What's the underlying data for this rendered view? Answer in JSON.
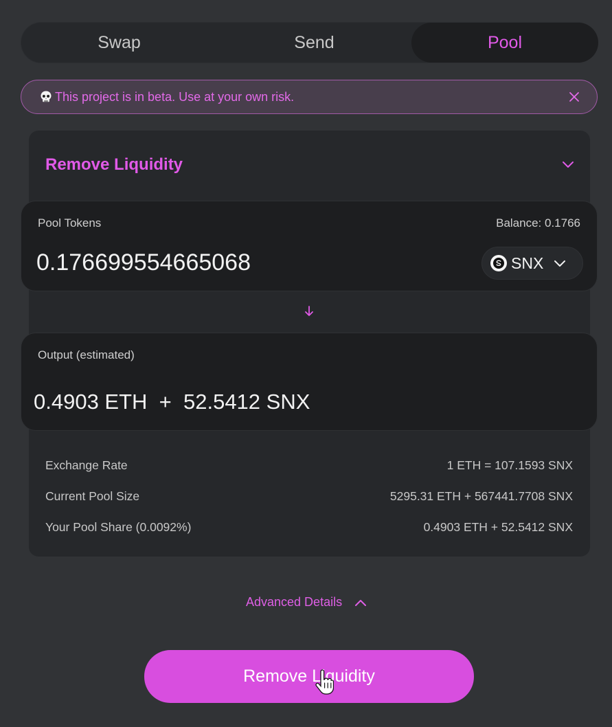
{
  "tabs": [
    {
      "label": "Swap"
    },
    {
      "label": "Send"
    },
    {
      "label": "Pool"
    }
  ],
  "active_tab": "Pool",
  "banner": {
    "icon": "skull-icon",
    "message": "This project is in beta. Use at your own risk."
  },
  "card": {
    "title": "Remove Liquidity"
  },
  "input_panel": {
    "label": "Pool Tokens",
    "balance": "Balance: 0.1766",
    "amount": "0.176699554665068",
    "token": "SNX"
  },
  "output_panel": {
    "label": "Output (estimated)",
    "amount": "0.4903 ETH  +  52.5412 SNX"
  },
  "details": [
    {
      "label": "Exchange Rate",
      "value": "1 ETH = 107.1593 SNX"
    },
    {
      "label": "Current Pool Size",
      "value": "5295.31 ETH + 567441.7708 SNX"
    },
    {
      "label": "Your Pool Share (0.0092%)",
      "value": "0.4903 ETH + 52.5412 SNX"
    }
  ],
  "advanced_details": "Advanced Details",
  "cta_label": "Remove Liquidity",
  "colors": {
    "accent": "#e15ae8",
    "background": "#313336",
    "panel": "#1d1e20",
    "card": "#26282b",
    "button": "#d84edf"
  }
}
